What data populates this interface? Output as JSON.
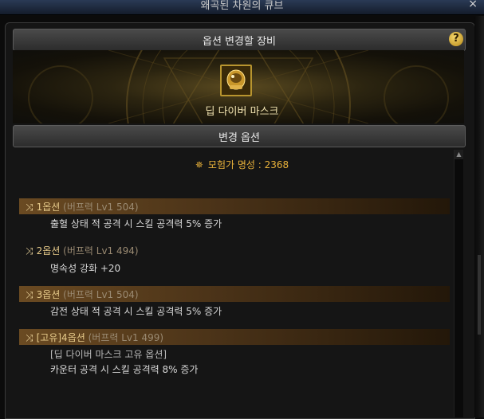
{
  "window": {
    "title": "왜곡된 차원의 큐브",
    "close_glyph": "×"
  },
  "header": {
    "title": "옵션 변경할 장비",
    "help_glyph": "?"
  },
  "item": {
    "name": "딥 다이버 마스크",
    "icon": "diving-mask-icon"
  },
  "section": {
    "title": "변경 옵션"
  },
  "fame": {
    "icon": "fame-emblem-icon",
    "text": "모험가 명성 : 2368"
  },
  "options": [
    {
      "title": "1옵션",
      "sub": "(버프력 Lv1 504)",
      "lines": [
        "출혈 상태 적 공격 시 스킬 공격력 5% 증가"
      ],
      "highlighted": true
    },
    {
      "title": "2옵션",
      "sub": "(버프력 Lv1 494)",
      "lines": [
        "명속성 강화 +20"
      ],
      "highlighted": false
    },
    {
      "title": "3옵션",
      "sub": "(버프력 Lv1 504)",
      "lines": [
        "감전 상태 적 공격 시 스킬 공격력 5% 증가"
      ],
      "highlighted": true
    },
    {
      "title": "[고유]4옵션",
      "sub": "(버프력 Lv1 499)",
      "lines": [
        "[딥 다이버 마스크 고유 옵션]",
        "카운터 공격 시 스킬 공격력 8% 증가"
      ],
      "highlighted": true
    }
  ],
  "colors": {
    "accent": "#e8b13a",
    "option_bar": "#6a4a22",
    "text": "#d8d8d8"
  }
}
